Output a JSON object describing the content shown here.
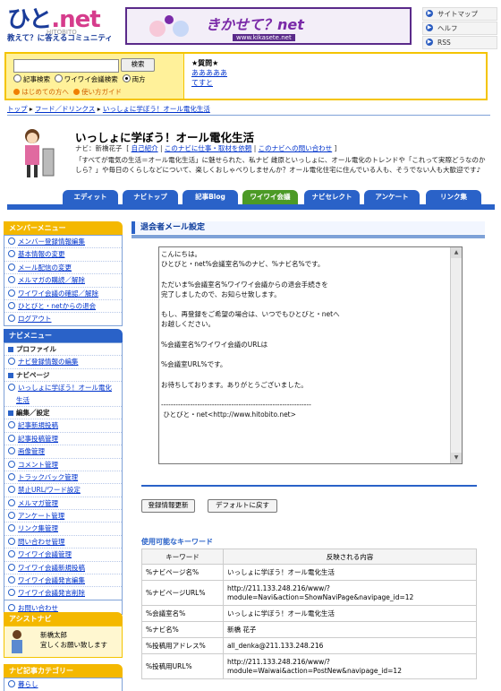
{
  "header": {
    "logo_main": "ひと",
    "logo_net": ".net",
    "logo_sub": "HITOBITO",
    "tagline": "教えて？に答えるコミュニティ",
    "banner_title": "きかせて？net",
    "banner_url": "www.kikasete.net",
    "top_links": [
      "サイトマップ",
      "ヘルフ",
      "RSS"
    ]
  },
  "search": {
    "input_value": "",
    "button": "検索",
    "options": [
      "記事検索",
      "ワイワイ会議検索",
      "両方"
    ],
    "selected": "両方",
    "help1": "はじめての方へ",
    "help2": "使い方ガイド",
    "right_items": [
      "★質問★",
      "あああああ",
      "てすと"
    ]
  },
  "breadcrumb": [
    "トップ",
    "フード／ドリンクス",
    "いっしょに学ぼう！オール電化生活"
  ],
  "profile": {
    "title": "いっしょに学ぼう！オール電化生活",
    "navi_label": "ナビ：",
    "navi_name": "新橋花子",
    "links": [
      "自己紹介",
      "このナビに仕事・取材を依頼",
      "このナビへの問い合わせ"
    ],
    "description": "「すべてが電気の生活＝オール電化生活」に魅せられた、私ナビ 雌原といっしょに、オール電化のトレンドや「これって実際どうなのかしら？」や毎日のくらしなどについて、楽しくおしゃべりしませんか？オール電化住宅に住んでいる人も、そうでない人も大歓迎です♪",
    "tabs": [
      "エディット",
      "ナビトップ",
      "記事Blog",
      "ワイワイ会議",
      "ナビセレクト",
      "アンケート",
      "リンク集"
    ],
    "active_tab": "ワイワイ会議"
  },
  "sidebar": {
    "member_menu": "メンバーメニュー",
    "member_items": [
      "メンバー登録情報編集",
      "基本情報の変更",
      "メール配信の変更",
      "メルマガの購読／解除",
      "ワイワイ会議の確認／解除",
      "ひとびと・netからの退会",
      "ログアウト"
    ],
    "navi_menu": "ナビメニュー",
    "navi_items": [
      {
        "label": "プロファイル",
        "head": true
      },
      {
        "label": "ナビ登録情報の編集"
      },
      {
        "label": "ナビページ",
        "head": true
      },
      {
        "label": "いっしょに学ぼう！オール電化"
      },
      {
        "label": "生活",
        "cont": true
      },
      {
        "label": "編集／設定",
        "head": true
      },
      {
        "label": "記事新規投稿"
      },
      {
        "label": "記事投稿管理"
      },
      {
        "label": "画像管理"
      },
      {
        "label": "コメント管理"
      },
      {
        "label": "トラックバック管理"
      },
      {
        "label": "禁止URL/ワード設定"
      },
      {
        "label": "メルマガ管理"
      },
      {
        "label": "アンケート管理"
      },
      {
        "label": "リンク集管理"
      },
      {
        "label": "問い合わせ管理"
      },
      {
        "label": "ワイワイ会議管理"
      },
      {
        "label": "ワイワイ会議新規投稿"
      },
      {
        "label": "ワイワイ会議発言編集"
      },
      {
        "label": "ワイワイ会議発言削除"
      },
      {
        "label": "お問い合わせ",
        "gap": true
      }
    ],
    "assist_head": "アシストナビ",
    "assist_name": "新橋太郎",
    "assist_msg": "宜しくお願い致します",
    "category_head": "ナビ記事カテゴリー",
    "category_first": "暮らし"
  },
  "main": {
    "title": "退会者メール設定",
    "mail_body": "こんにちは。\nひとびと・net%会議室名%のナビ、%ナビ名%です。\n\nただいま%会議室名%ワイワイ会議からの退会手続きを\n完了しましたので、お知らせ致します。\n\nもし、再登録をご希望の場合は、いつでもひとびと・netへ\nお越しください。\n\n%会議室名%ワイワイ会議のURLは\n\n%会議室URL%です。\n\nお待ちしております。ありがとうございました。\n\n--------------------------------------------------------------\n ひとびと・net<http://www.hitobito.net>",
    "btn_save": "登録情報更新",
    "btn_default": "デフォルトに戻す",
    "kw_title": "使用可能なキーワード",
    "kw_headers": [
      "キーワード",
      "反映される内容"
    ],
    "kw_rows": [
      [
        "%ナビページ名%",
        "いっしょに学ぼう！オール電化生活"
      ],
      [
        "%ナビページURL%",
        "http://211.133.248.216/www/?module=Navi&action=ShowNaviPage&navipage_id=12"
      ],
      [
        "%会議室名%",
        "いっしょに学ぼう！オール電化生活"
      ],
      [
        "%ナビ名%",
        "新橋 花子"
      ],
      [
        "%投稿用アドレス%",
        "all_denka@211.133.248.216"
      ],
      [
        "%投稿用URL%",
        "http://211.133.248.216/www/?module=Waiwai&action=PostNew&navipage_id=12"
      ]
    ]
  }
}
